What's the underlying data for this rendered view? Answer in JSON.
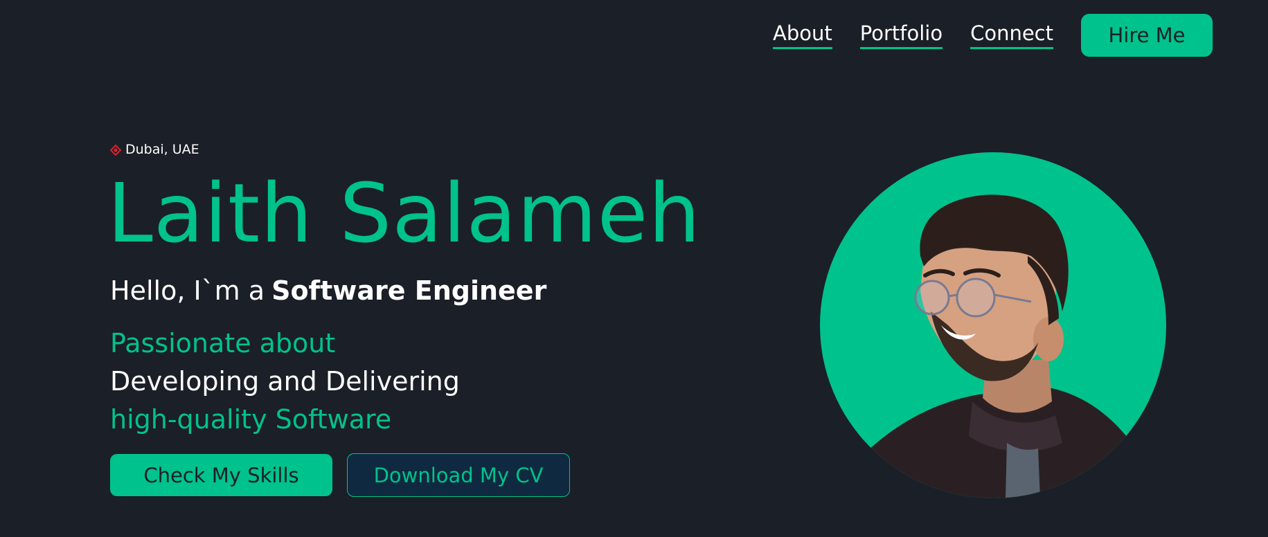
{
  "nav": {
    "links": [
      {
        "label": "About"
      },
      {
        "label": "Portfolio"
      },
      {
        "label": "Connect"
      }
    ],
    "hire_label": "Hire Me"
  },
  "hero": {
    "location": "Dubai, UAE",
    "location_icon": "location-pin-icon",
    "name": "Laith Salameh",
    "intro_prefix": "Hello, I`m a",
    "role": "Software Engineer",
    "tagline": [
      "Passionate about",
      "Developing and Delivering",
      "high-quality Software"
    ],
    "primary_button": "Check My Skills",
    "secondary_button": "Download My CV"
  },
  "colors": {
    "background": "#1b1f27",
    "accent": "#00c28c",
    "text": "#ffffff",
    "secondary_button_bg": "#0f2a40",
    "location_icon": "#e0202a"
  }
}
